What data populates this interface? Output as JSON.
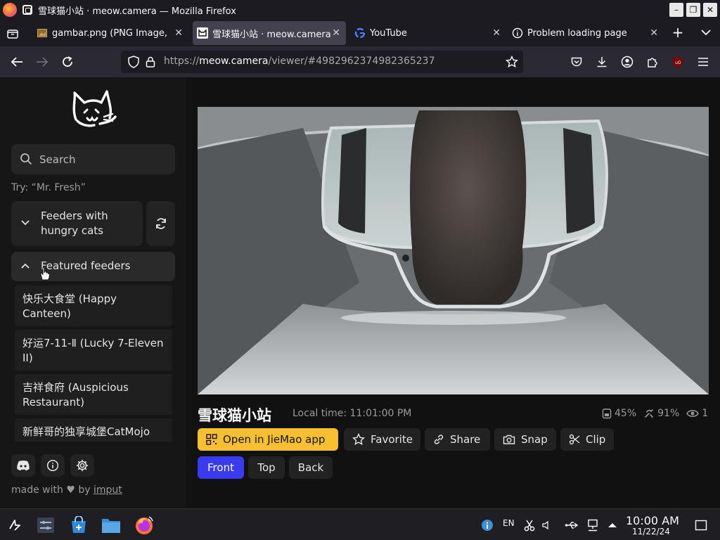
{
  "window": {
    "title": "雪球猫小站 · meow.camera — Mozilla Firefox"
  },
  "tabs": [
    {
      "label": "gambar.png (PNG Image, ",
      "icon": "image-file-icon",
      "active": false
    },
    {
      "label": "雪球猫小站 · meow.camera",
      "icon": "cat-favicon-icon",
      "active": true
    },
    {
      "label": "YouTube",
      "icon": "google-g-icon",
      "active": false
    },
    {
      "label": "Problem loading page",
      "icon": "info-icon",
      "active": false
    }
  ],
  "nav": {
    "url_prefix": "https://",
    "url_host": "meow.camera",
    "url_path": "/viewer/#4982962374982365237"
  },
  "sidebar": {
    "search_placeholder": "Search",
    "hint": "Try: “Mr. Fresh”",
    "group_hungry_label": "Feeders with hungry cats",
    "group_featured_label": "Featured feeders",
    "feeders": [
      "快乐大食堂 (Happy Canteen)",
      "好运7-11-Ⅱ (Lucky 7-Eleven II)",
      "吉祥食府 (Auspicious Restaurant)",
      "新鲜哥的独享城堡CatMojo"
    ],
    "made_prefix": "made with",
    "made_by": "by",
    "made_link": "imput"
  },
  "main": {
    "cam_title": "雪球猫小站",
    "local_time": "Local time: 11:01:00 PM",
    "stats": {
      "food": "45%",
      "water": "91%",
      "viewers": "1"
    },
    "actions": {
      "open_app": "Open in JieMao app",
      "favorite": "Favorite",
      "share": "Share",
      "snap": "Snap",
      "clip": "Clip"
    },
    "views": {
      "front": "Front",
      "top": "Top",
      "back": "Back"
    },
    "active_view": "Front"
  },
  "taskbar": {
    "lang": "EN",
    "time": "10:00 AM",
    "date": "11/22/24"
  },
  "colors": {
    "accent_yellow": "#f8c030",
    "accent_blue": "#3a3af0"
  }
}
